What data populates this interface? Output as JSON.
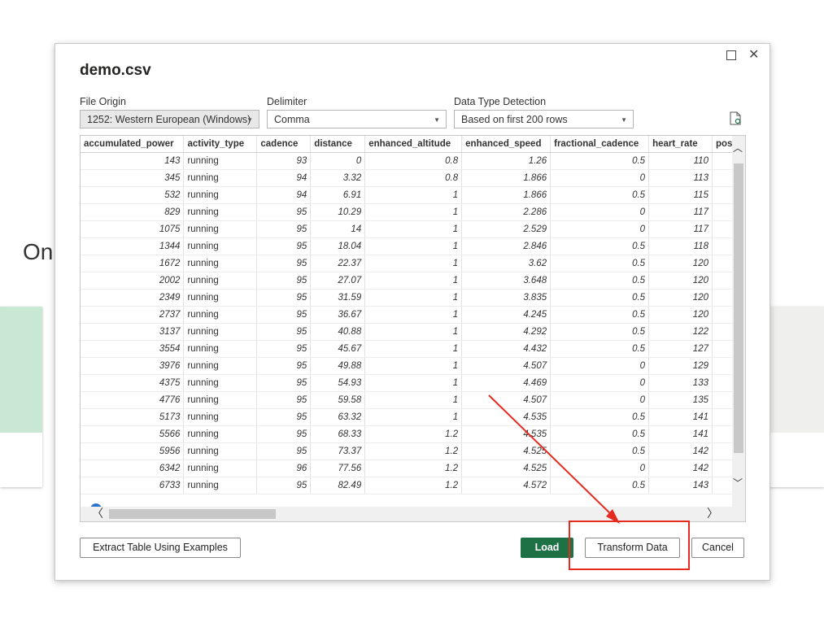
{
  "background": {
    "partial_text": "On"
  },
  "dialog": {
    "title": "demo.csv",
    "file_origin": {
      "label": "File Origin",
      "value": "1252: Western European (Windows)"
    },
    "delimiter": {
      "label": "Delimiter",
      "value": "Comma"
    },
    "data_type_detection": {
      "label": "Data Type Detection",
      "value": "Based on first 200 rows"
    },
    "table": {
      "columns": [
        "accumulated_power",
        "activity_type",
        "cadence",
        "distance",
        "enhanced_altitude",
        "enhanced_speed",
        "fractional_cadence",
        "heart_rate",
        "posi"
      ],
      "rows": [
        [
          "143",
          "running",
          "93",
          "0",
          "0.8",
          "1.26",
          "0.5",
          "110",
          ""
        ],
        [
          "345",
          "running",
          "94",
          "3.32",
          "0.8",
          "1.866",
          "0",
          "113",
          ""
        ],
        [
          "532",
          "running",
          "94",
          "6.91",
          "1",
          "1.866",
          "0.5",
          "115",
          ""
        ],
        [
          "829",
          "running",
          "95",
          "10.29",
          "1",
          "2.286",
          "0",
          "117",
          ""
        ],
        [
          "1075",
          "running",
          "95",
          "14",
          "1",
          "2.529",
          "0",
          "117",
          ""
        ],
        [
          "1344",
          "running",
          "95",
          "18.04",
          "1",
          "2.846",
          "0.5",
          "118",
          ""
        ],
        [
          "1672",
          "running",
          "95",
          "22.37",
          "1",
          "3.62",
          "0.5",
          "120",
          ""
        ],
        [
          "2002",
          "running",
          "95",
          "27.07",
          "1",
          "3.648",
          "0.5",
          "120",
          ""
        ],
        [
          "2349",
          "running",
          "95",
          "31.59",
          "1",
          "3.835",
          "0.5",
          "120",
          ""
        ],
        [
          "2737",
          "running",
          "95",
          "36.67",
          "1",
          "4.245",
          "0.5",
          "120",
          ""
        ],
        [
          "3137",
          "running",
          "95",
          "40.88",
          "1",
          "4.292",
          "0.5",
          "122",
          ""
        ],
        [
          "3554",
          "running",
          "95",
          "45.67",
          "1",
          "4.432",
          "0.5",
          "127",
          ""
        ],
        [
          "3976",
          "running",
          "95",
          "49.88",
          "1",
          "4.507",
          "0",
          "129",
          ""
        ],
        [
          "4375",
          "running",
          "95",
          "54.93",
          "1",
          "4.469",
          "0",
          "133",
          ""
        ],
        [
          "4776",
          "running",
          "95",
          "59.58",
          "1",
          "4.507",
          "0",
          "135",
          ""
        ],
        [
          "5173",
          "running",
          "95",
          "63.32",
          "1",
          "4.535",
          "0.5",
          "141",
          ""
        ],
        [
          "5566",
          "running",
          "95",
          "68.33",
          "1.2",
          "4.535",
          "0.5",
          "141",
          ""
        ],
        [
          "5956",
          "running",
          "95",
          "73.37",
          "1.2",
          "4.525",
          "0.5",
          "142",
          ""
        ],
        [
          "6342",
          "running",
          "96",
          "77.56",
          "1.2",
          "4.525",
          "0",
          "142",
          ""
        ],
        [
          "6733",
          "running",
          "95",
          "82.49",
          "1.2",
          "4.572",
          "0.5",
          "143",
          ""
        ]
      ]
    },
    "buttons": {
      "extract": "Extract Table Using Examples",
      "load": "Load",
      "transform": "Transform Data",
      "cancel": "Cancel"
    }
  },
  "colors": {
    "load_button": "#1e7145",
    "annotation": "#e52b1f"
  }
}
